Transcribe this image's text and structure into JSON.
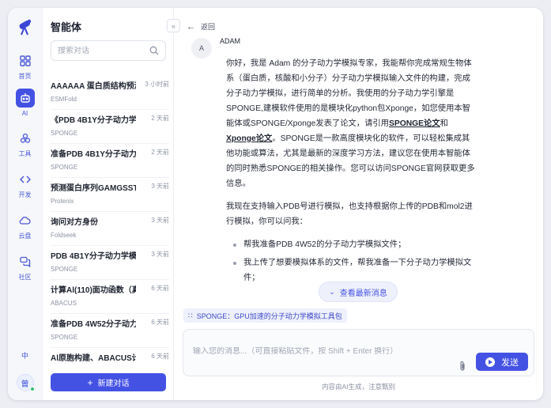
{
  "rail": {
    "items": [
      {
        "label": "首页",
        "icon": "home-grid-icon"
      },
      {
        "label": "AI",
        "icon": "robot-icon"
      },
      {
        "label": "工具",
        "icon": "tools-icon"
      },
      {
        "label": "开发",
        "icon": "code-icon"
      },
      {
        "label": "云盘",
        "icon": "cloud-icon"
      },
      {
        "label": "社区",
        "icon": "chat-icon"
      }
    ],
    "lang": "中",
    "avatar": "曾"
  },
  "panel": {
    "title": "智能体",
    "search_placeholder": "搜索对话",
    "conversations": [
      {
        "title": "AAAAAA 蛋白质结构预测",
        "time": "3 小时前",
        "agent": "ESMFold"
      },
      {
        "title": "《PDB 4B1Y分子动力学模...",
        "time": "2 天前",
        "agent": "SPONGE"
      },
      {
        "title": "准备PDB 4B1Y分子动力学...",
        "time": "2 天前",
        "agent": "SPONGE"
      },
      {
        "title": "预测蛋白序列GAMGSSTS...",
        "time": "3 天前",
        "agent": "Protenix"
      },
      {
        "title": "询问对方身份",
        "time": "3 天前",
        "agent": "Foldseek"
      },
      {
        "title": "PDB 4B1Y分子动力学模拟...",
        "time": "3 天前",
        "agent": "SPONGE"
      },
      {
        "title": "计算Al(110)面功函数（真...",
        "time": "6 天前",
        "agent": "ABACUS"
      },
      {
        "title": "准备PDB 4W52分子动力...",
        "time": "6 天前",
        "agent": "SPONGE"
      },
      {
        "title": "Al原胞构建、ABACUS计...",
        "time": "6 天前",
        "agent": ""
      }
    ],
    "new_button": "新建对话"
  },
  "main": {
    "back": "返回",
    "bot_avatar": "A",
    "bot_name": "ADAM",
    "message": {
      "p1_a": "你好，我是 Adam 的分子动力学模拟专家，我能帮你完成常规生物体系（蛋白质，核酸和小分子）分子动力学模拟输入文件的构建，完成分子动力学模拟，进行简单的分析。我使用的分子动力学引擎是SPONGE,建模软件使用的是模块化python包Xponge，如您使用本智能体或SPONGE/Xponge发表了论文，请引用",
      "link1": "SPONGE论文",
      "p1_b": "和",
      "link2": "Xponge论文",
      "p1_c": "。SPONGE是一款高度模块化的软件，可以轻松集成其他功能或算法，尤其是最新的深度学习方法，建议您在使用本智能体的同时熟悉SPONGE的相关操作。您可以访问SPONGE官网获取更多信息。",
      "p2": "我现在支持输入PDB号进行模拟，也支持根据你上传的PDB和mol2进行模拟，你可以问我：",
      "bullets": [
        "帮我准备PDB 4W52的分子动力学模拟文件；",
        "我上传了想要模拟体系的文件，帮我准备一下分子动力学模拟文件；"
      ]
    },
    "latest_button": "查看最新消息",
    "tool_chip": "SPONGE：GPU加速的分子动力学模拟工具包",
    "composer_placeholder": "输入您的消息...（可直接粘贴文件，按 Shift + Enter 换行）",
    "send": "发送",
    "disclaimer": "内容由AI生成，注意甄别"
  },
  "colors": {
    "accent": "#4452e4",
    "rail_bg": "#f6f7fb",
    "page_bg": "#eceef3"
  }
}
